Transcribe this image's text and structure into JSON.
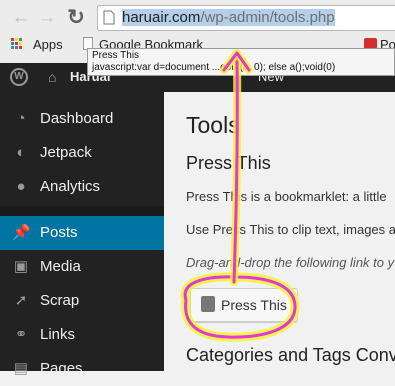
{
  "browser": {
    "url_selected": "haruair.com",
    "url_rest": "/wp-admin/tools.php",
    "bookmarks": [
      {
        "label": "Apps",
        "icon": "apps-grid-icon"
      },
      {
        "label": "Google Bookmark",
        "icon": "page-icon"
      },
      {
        "label": "Po",
        "icon": "pocket-icon"
      }
    ],
    "tooltip": {
      "title": "Press This",
      "body": "javascript:var d=document ...eout(a, 0); else a();void(0)"
    }
  },
  "adminbar": {
    "site_name": "Haruai",
    "new_label": "New"
  },
  "sidebar": {
    "items": [
      {
        "label": "Dashboard",
        "icon": "dashboard-icon"
      },
      {
        "label": "Jetpack",
        "icon": "jetpack-icon"
      },
      {
        "label": "Analytics",
        "icon": "analytics-icon"
      },
      {
        "label": "Posts",
        "icon": "pushpin-icon",
        "active": true
      },
      {
        "label": "Media",
        "icon": "media-icon"
      },
      {
        "label": "Scrap",
        "icon": "pushpin-icon"
      },
      {
        "label": "Links",
        "icon": "link-icon"
      },
      {
        "label": "Pages",
        "icon": "page-icon"
      }
    ]
  },
  "main": {
    "title": "Tools",
    "press_this_heading": "Press This",
    "para1": "Press This is a bookmarklet: a little",
    "para2": "Use Press This to clip text, images a",
    "para3": "Drag-and-drop the following link to y",
    "press_button_label": "Press This",
    "categories_heading": "Categories and Tags Conv"
  },
  "colors": {
    "admin_dark": "#222222",
    "active_blue": "#0074a2",
    "annotation_magenta": "#e635d8",
    "annotation_yellow": "#f4f530"
  }
}
